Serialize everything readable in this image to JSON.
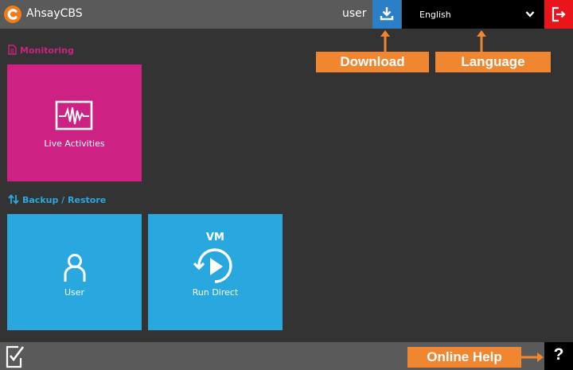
{
  "header": {
    "app_title": "AhsayCBS",
    "user_label": "user",
    "download_icon": "download-icon",
    "language": {
      "selected": "English"
    },
    "logout_icon": "logout-icon"
  },
  "sections": {
    "monitoring": {
      "title": "Monitoring",
      "icon": "document-icon"
    },
    "backup_restore": {
      "title": "Backup / Restore",
      "icon": "up-down-arrows-icon"
    }
  },
  "tiles": {
    "live_activities": {
      "label": "Live Activities",
      "icon": "activity-monitor-icon"
    },
    "user": {
      "label": "User",
      "icon": "user-icon"
    },
    "run_direct": {
      "label": "Run Direct",
      "badge": "VM",
      "icon": "play-circle-icon"
    }
  },
  "callouts": {
    "download": "Download",
    "language": "Language",
    "online_help": "Online Help"
  },
  "footer": {
    "help_glyph": "?",
    "checklist_icon": "checklist-icon"
  },
  "colors": {
    "background": "#333333",
    "bar": "#5a5a5a",
    "monitoring": "#cd2283",
    "backup": "#29a8e0",
    "download": "#2a7fc6",
    "logout": "#e8151b",
    "callout": "#f08630",
    "logo": "#f07d1a"
  }
}
